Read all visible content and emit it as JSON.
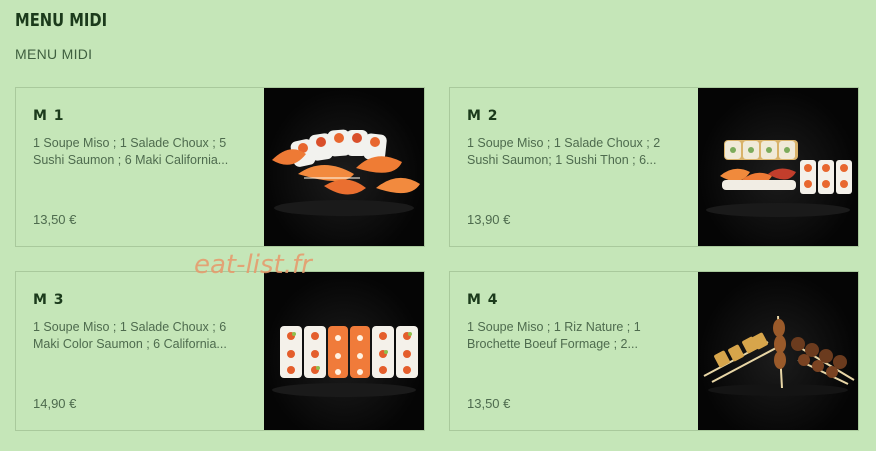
{
  "section": {
    "title": "MENU MIDI",
    "subtitle": "MENU MIDI"
  },
  "watermark": "eat-list.fr",
  "items": [
    {
      "name": "M 1",
      "description": "1 Soupe Miso ; 1 Salade Choux ; 5 Sushi Saumon ; 6 Maki California...",
      "price": "13,50 €",
      "image_icon": "sushi-salmon-plate"
    },
    {
      "name": "M 2",
      "description": "1 Soupe Miso ; 1 Salade Choux ; 2 Sushi Saumon; 1 Sushi Thon ; 6...",
      "price": "13,90 €",
      "image_icon": "sushi-assortment-plate"
    },
    {
      "name": "M 3",
      "description": "1 Soupe Miso ; 1 Salade Choux ; 6 Maki Color Saumon ; 6 California...",
      "price": "14,90 €",
      "image_icon": "maki-rolls-plate"
    },
    {
      "name": "M 4",
      "description": "1 Soupe Miso ; 1 Riz Nature ; 1 Brochette Boeuf Formage ; 2...",
      "price": "13,50 €",
      "image_icon": "yakitori-skewers-plate"
    }
  ]
}
